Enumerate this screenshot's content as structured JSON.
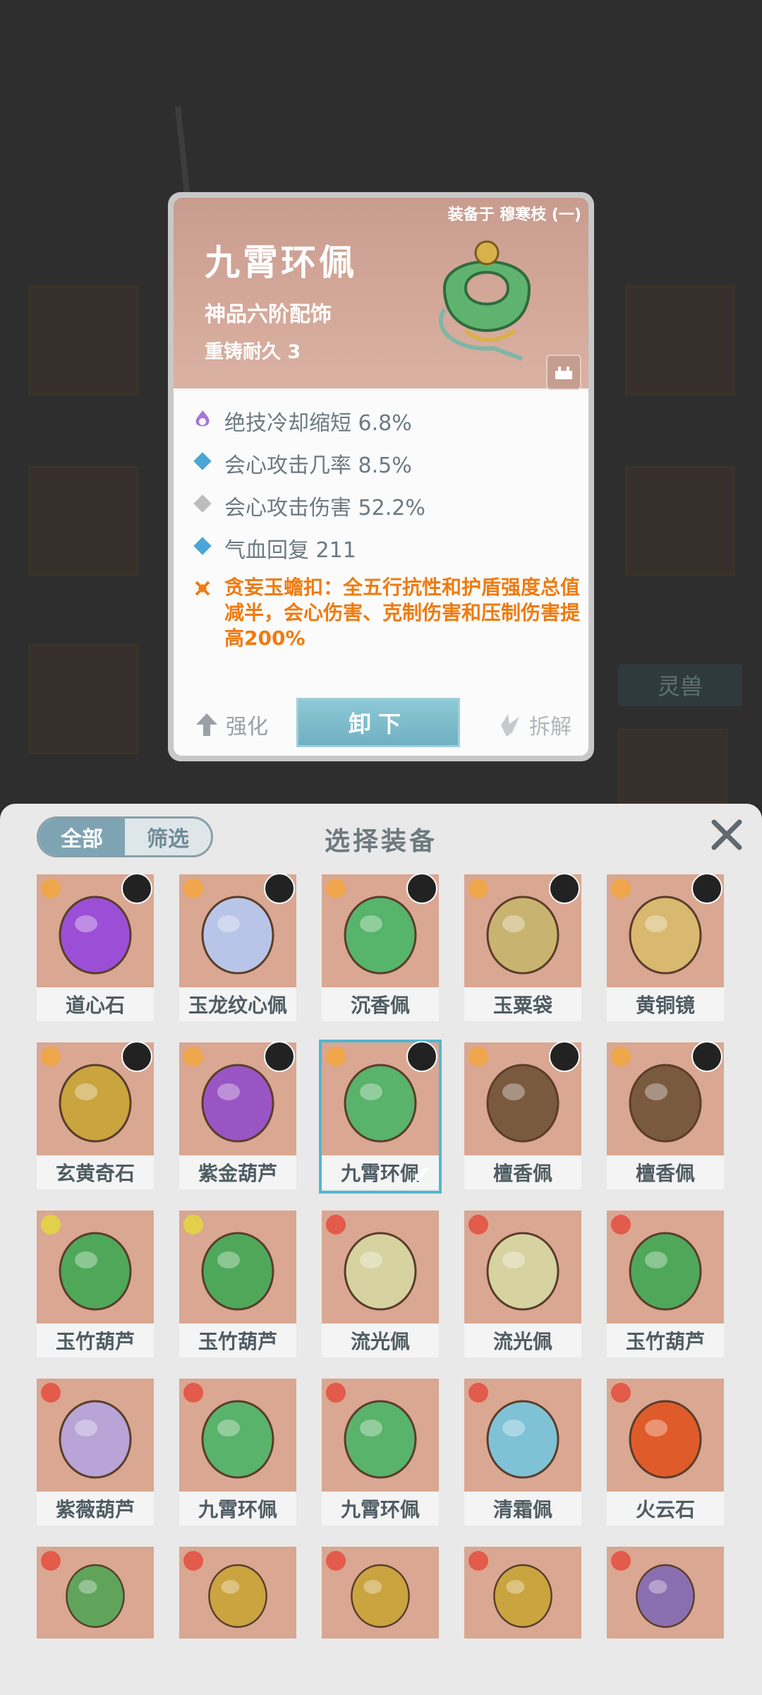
{
  "detail": {
    "equipped_label": "装备于 穆寒枝 (一)",
    "name": "九霄环佩",
    "grade": "神品六阶配饰",
    "reforge": "重铸耐久 3",
    "stats": [
      {
        "icon": "flame-purple-icon",
        "text": "绝技冷却缩短 6.8%",
        "color": "#9b6fd2"
      },
      {
        "icon": "diamond-blue-icon",
        "text": "会心攻击几率 8.5%",
        "color": "#4aa6d6"
      },
      {
        "icon": "diamond-gray-icon",
        "text": "会心攻击伤害 52.2%",
        "color": "#b9b9b9"
      },
      {
        "icon": "diamond-blue-icon",
        "text": "气血回复 211",
        "color": "#4aa6d6"
      }
    ],
    "skill_icon": "skill-orange-icon",
    "skill_text": "贪妄玉蟾扣：全五行抗性和护盾强度总值减半，会心伤害、克制伤害和压制伤害提高200%",
    "strengthen_label": "强化",
    "unequip_label": "卸下",
    "dismantle_label": "拆解"
  },
  "background": {
    "spirit_tab": "灵兽"
  },
  "panel": {
    "tabs": {
      "all": "全部",
      "filter": "筛选"
    },
    "title": "选择装备",
    "items": [
      {
        "name": "道心石",
        "art_color": "#9b4fd6",
        "elem_color": "#f0a64a"
      },
      {
        "name": "玉龙纹心佩",
        "art_color": "#b9c5e8",
        "elem_color": "#f0a64a"
      },
      {
        "name": "沉香佩",
        "art_color": "#57b46b",
        "elem_color": "#f0a64a"
      },
      {
        "name": "玉粟袋",
        "art_color": "#c9b370",
        "elem_color": "#f0a64a"
      },
      {
        "name": "黄铜镜",
        "art_color": "#d8b96f",
        "elem_color": "#f0a64a"
      },
      {
        "name": "玄黄奇石",
        "art_color": "#c9a43f",
        "elem_color": "#f0a64a"
      },
      {
        "name": "紫金葫芦",
        "art_color": "#9a55c4",
        "elem_color": "#f0a64a"
      },
      {
        "name": "九霄环佩",
        "art_color": "#59b36a",
        "elem_color": "#f0a64a",
        "selected": true
      },
      {
        "name": "檀香佩",
        "art_color": "#7a5a3f",
        "elem_color": "#f0a64a"
      },
      {
        "name": "檀香佩",
        "art_color": "#7a5a3f",
        "elem_color": "#f0a64a"
      },
      {
        "name": "玉竹葫芦",
        "art_color": "#4fa85a",
        "elem_color": "#e2d04a"
      },
      {
        "name": "玉竹葫芦",
        "art_color": "#4fa85a",
        "elem_color": "#e2d04a"
      },
      {
        "name": "流光佩",
        "art_color": "#d6d3a0",
        "elem_color": "#e35b4a"
      },
      {
        "name": "流光佩",
        "art_color": "#d6d3a0",
        "elem_color": "#e35b4a"
      },
      {
        "name": "玉竹葫芦",
        "art_color": "#4fa85a",
        "elem_color": "#e35b4a"
      },
      {
        "name": "紫薇葫芦",
        "art_color": "#b8a4d6",
        "elem_color": "#e35b4a"
      },
      {
        "name": "九霄环佩",
        "art_color": "#59b36a",
        "elem_color": "#e35b4a"
      },
      {
        "name": "九霄环佩",
        "art_color": "#59b36a",
        "elem_color": "#e35b4a"
      },
      {
        "name": "清霜佩",
        "art_color": "#7fc2d6",
        "elem_color": "#e35b4a"
      },
      {
        "name": "火云石",
        "art_color": "#e05b2a",
        "elem_color": "#e35b4a"
      },
      {
        "name": "",
        "art_color": "#5fa45a",
        "elem_color": "#e35b4a"
      },
      {
        "name": "",
        "art_color": "#c9a43f",
        "elem_color": "#e35b4a"
      },
      {
        "name": "",
        "art_color": "#c9a43f",
        "elem_color": "#e35b4a"
      },
      {
        "name": "",
        "art_color": "#c9a43f",
        "elem_color": "#e35b4a"
      },
      {
        "name": "",
        "art_color": "#8a6fb0",
        "elem_color": "#e35b4a"
      }
    ]
  }
}
